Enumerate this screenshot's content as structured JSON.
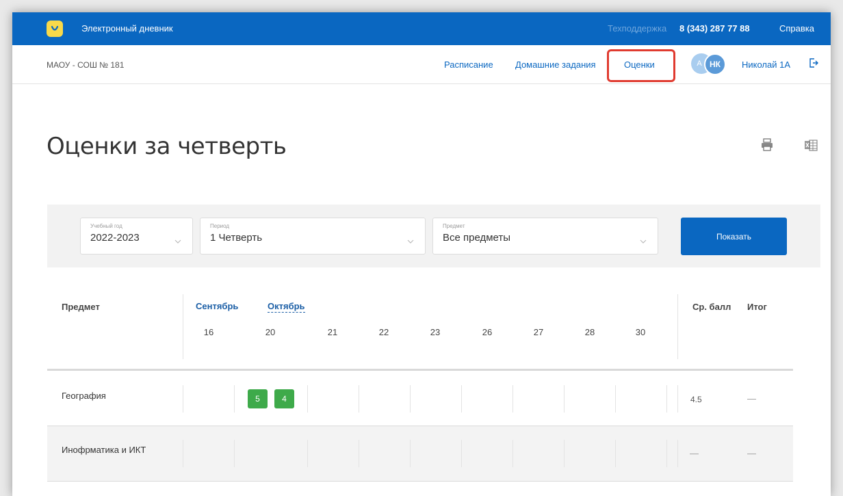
{
  "topbar": {
    "app_title": "Электронный дневник",
    "support_label": "Техподдержка",
    "support_phone": "8 (343) 287 77 88",
    "help": "Справка"
  },
  "navbar": {
    "school": "МАОУ - СОШ № 181",
    "links": [
      "Расписание",
      "Домашние задания",
      "Оценки"
    ],
    "active_link": "Оценки",
    "avatar_secondary": "А",
    "avatar_primary": "НК",
    "user_name": "Николай 1А"
  },
  "page": {
    "title": "Оценки за четверть"
  },
  "filters": {
    "year": {
      "label": "Учебный год",
      "value": "2022-2023"
    },
    "period": {
      "label": "Период",
      "value": "1 Четверть"
    },
    "subject": {
      "label": "Предмет",
      "value": "Все предметы"
    },
    "show_button": "Показать"
  },
  "table": {
    "subject_header": "Предмет",
    "months": [
      "Сентябрь",
      "Октябрь"
    ],
    "active_month": "Октябрь",
    "days": [
      "16",
      "20",
      "21",
      "22",
      "23",
      "26",
      "27",
      "28",
      "30"
    ],
    "avg_header": "Ср. балл",
    "final_header": "Итог",
    "rows": [
      {
        "subject": "География",
        "grades": [
          "5",
          "4"
        ],
        "avg": "4.5",
        "final": "—"
      },
      {
        "subject": "Инофрматика и ИКТ",
        "grades": [],
        "avg": "—",
        "final": "—"
      }
    ]
  },
  "colors": {
    "brand_blue": "#0a67c1",
    "grade_green": "#3eaa4a",
    "highlight_red": "#e03a2f"
  }
}
